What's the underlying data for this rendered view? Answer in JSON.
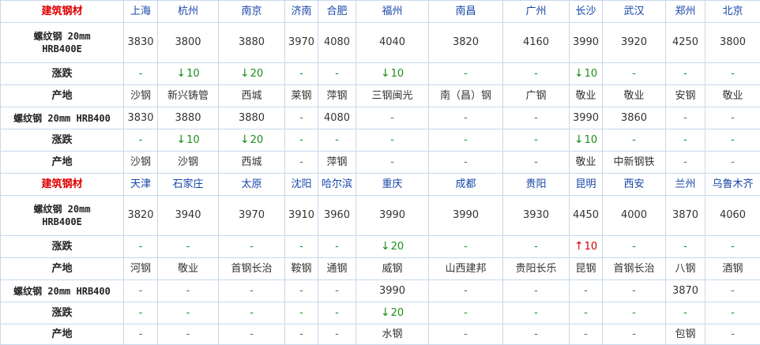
{
  "colors": {
    "header_red": "#e00000",
    "city_blue": "#1646a8",
    "down_green": "#1a8f1a",
    "up_red": "#d00000",
    "border": "#c8d8ec"
  },
  "icons": {
    "down": "arrow-down-icon",
    "up": "arrow-up-icon"
  },
  "sections": [
    {
      "header": "建筑钢材",
      "cities": [
        "上海",
        "杭州",
        "南京",
        "济南",
        "合肥",
        "福州",
        "南昌",
        "广州",
        "长沙",
        "武汉",
        "郑州",
        "北京"
      ],
      "blocks": [
        {
          "label_lines": [
            "螺纹钢 20mm",
            "HRB400E"
          ],
          "prices": [
            "3830",
            "3800",
            "3880",
            "3970",
            "4080",
            "4040",
            "3820",
            "4160",
            "3990",
            "3920",
            "4250",
            "3800"
          ],
          "change_label": "涨跌",
          "changes": [
            {
              "dir": "none",
              "text": "-"
            },
            {
              "dir": "down",
              "text": "10"
            },
            {
              "dir": "down",
              "text": "20"
            },
            {
              "dir": "none",
              "text": "-"
            },
            {
              "dir": "none",
              "text": "-"
            },
            {
              "dir": "down",
              "text": "10"
            },
            {
              "dir": "none",
              "text": "-"
            },
            {
              "dir": "none",
              "text": "-"
            },
            {
              "dir": "down",
              "text": "10"
            },
            {
              "dir": "none",
              "text": "-"
            },
            {
              "dir": "none",
              "text": "-"
            },
            {
              "dir": "none",
              "text": "-"
            }
          ],
          "origin_label": "产地",
          "origins": [
            "沙钢",
            "新兴铸管",
            "西城",
            "莱钢",
            "萍钢",
            "三钢闽光",
            "南（昌）钢",
            "广钢",
            "敬业",
            "敬业",
            "安钢",
            "敬业"
          ]
        },
        {
          "label_lines": [
            "螺纹钢 20mm HRB400"
          ],
          "prices": [
            "3830",
            "3880",
            "3880",
            "-",
            "4080",
            "-",
            "-",
            "-",
            "3990",
            "3860",
            "-",
            "-"
          ],
          "change_label": "涨跌",
          "changes": [
            {
              "dir": "none",
              "text": "-"
            },
            {
              "dir": "down",
              "text": "10"
            },
            {
              "dir": "down",
              "text": "20"
            },
            {
              "dir": "none",
              "text": "-"
            },
            {
              "dir": "none",
              "text": "-"
            },
            {
              "dir": "none",
              "text": "-"
            },
            {
              "dir": "none",
              "text": "-"
            },
            {
              "dir": "none",
              "text": "-"
            },
            {
              "dir": "down",
              "text": "10"
            },
            {
              "dir": "none",
              "text": "-"
            },
            {
              "dir": "none",
              "text": "-"
            },
            {
              "dir": "none",
              "text": "-"
            }
          ],
          "origin_label": "产地",
          "origins": [
            "沙钢",
            "沙钢",
            "西城",
            "-",
            "萍钢",
            "-",
            "-",
            "-",
            "敬业",
            "中新钢铁",
            "-",
            "-"
          ]
        }
      ]
    },
    {
      "header": "建筑钢材",
      "cities": [
        "天津",
        "石家庄",
        "太原",
        "沈阳",
        "哈尔滨",
        "重庆",
        "成都",
        "贵阳",
        "昆明",
        "西安",
        "兰州",
        "乌鲁木齐"
      ],
      "blocks": [
        {
          "label_lines": [
            "螺纹钢 20mm",
            "HRB400E"
          ],
          "prices": [
            "3820",
            "3940",
            "3970",
            "3910",
            "3960",
            "3990",
            "3990",
            "3930",
            "4450",
            "4000",
            "3870",
            "4060"
          ],
          "change_label": "涨跌",
          "changes": [
            {
              "dir": "none",
              "text": "-"
            },
            {
              "dir": "none",
              "text": "-"
            },
            {
              "dir": "none",
              "text": "-"
            },
            {
              "dir": "none",
              "text": "-"
            },
            {
              "dir": "none",
              "text": "-"
            },
            {
              "dir": "down",
              "text": "20"
            },
            {
              "dir": "none",
              "text": "-"
            },
            {
              "dir": "none",
              "text": "-"
            },
            {
              "dir": "up",
              "text": "10"
            },
            {
              "dir": "none",
              "text": "-"
            },
            {
              "dir": "none",
              "text": "-"
            },
            {
              "dir": "none",
              "text": "-"
            }
          ],
          "origin_label": "产地",
          "origins": [
            "河钢",
            "敬业",
            "首钢长治",
            "鞍钢",
            "通钢",
            "威钢",
            "山西建邦",
            "贵阳长乐",
            "昆钢",
            "首钢长治",
            "八钢",
            "酒钢"
          ]
        },
        {
          "label_lines": [
            "螺纹钢 20mm HRB400"
          ],
          "prices": [
            "-",
            "-",
            "-",
            "-",
            "-",
            "3990",
            "-",
            "-",
            "-",
            "-",
            "3870",
            "-"
          ],
          "change_label": "涨跌",
          "changes": [
            {
              "dir": "none",
              "text": "-"
            },
            {
              "dir": "none",
              "text": "-"
            },
            {
              "dir": "none",
              "text": "-"
            },
            {
              "dir": "none",
              "text": "-"
            },
            {
              "dir": "none",
              "text": "-"
            },
            {
              "dir": "down",
              "text": "20"
            },
            {
              "dir": "none",
              "text": "-"
            },
            {
              "dir": "none",
              "text": "-"
            },
            {
              "dir": "none",
              "text": "-"
            },
            {
              "dir": "none",
              "text": "-"
            },
            {
              "dir": "none",
              "text": "-"
            },
            {
              "dir": "none",
              "text": "-"
            }
          ],
          "origin_label": "产地",
          "origins": [
            "-",
            "-",
            "-",
            "-",
            "-",
            "水钢",
            "-",
            "-",
            "-",
            "-",
            "包钢",
            "-"
          ]
        }
      ]
    }
  ]
}
